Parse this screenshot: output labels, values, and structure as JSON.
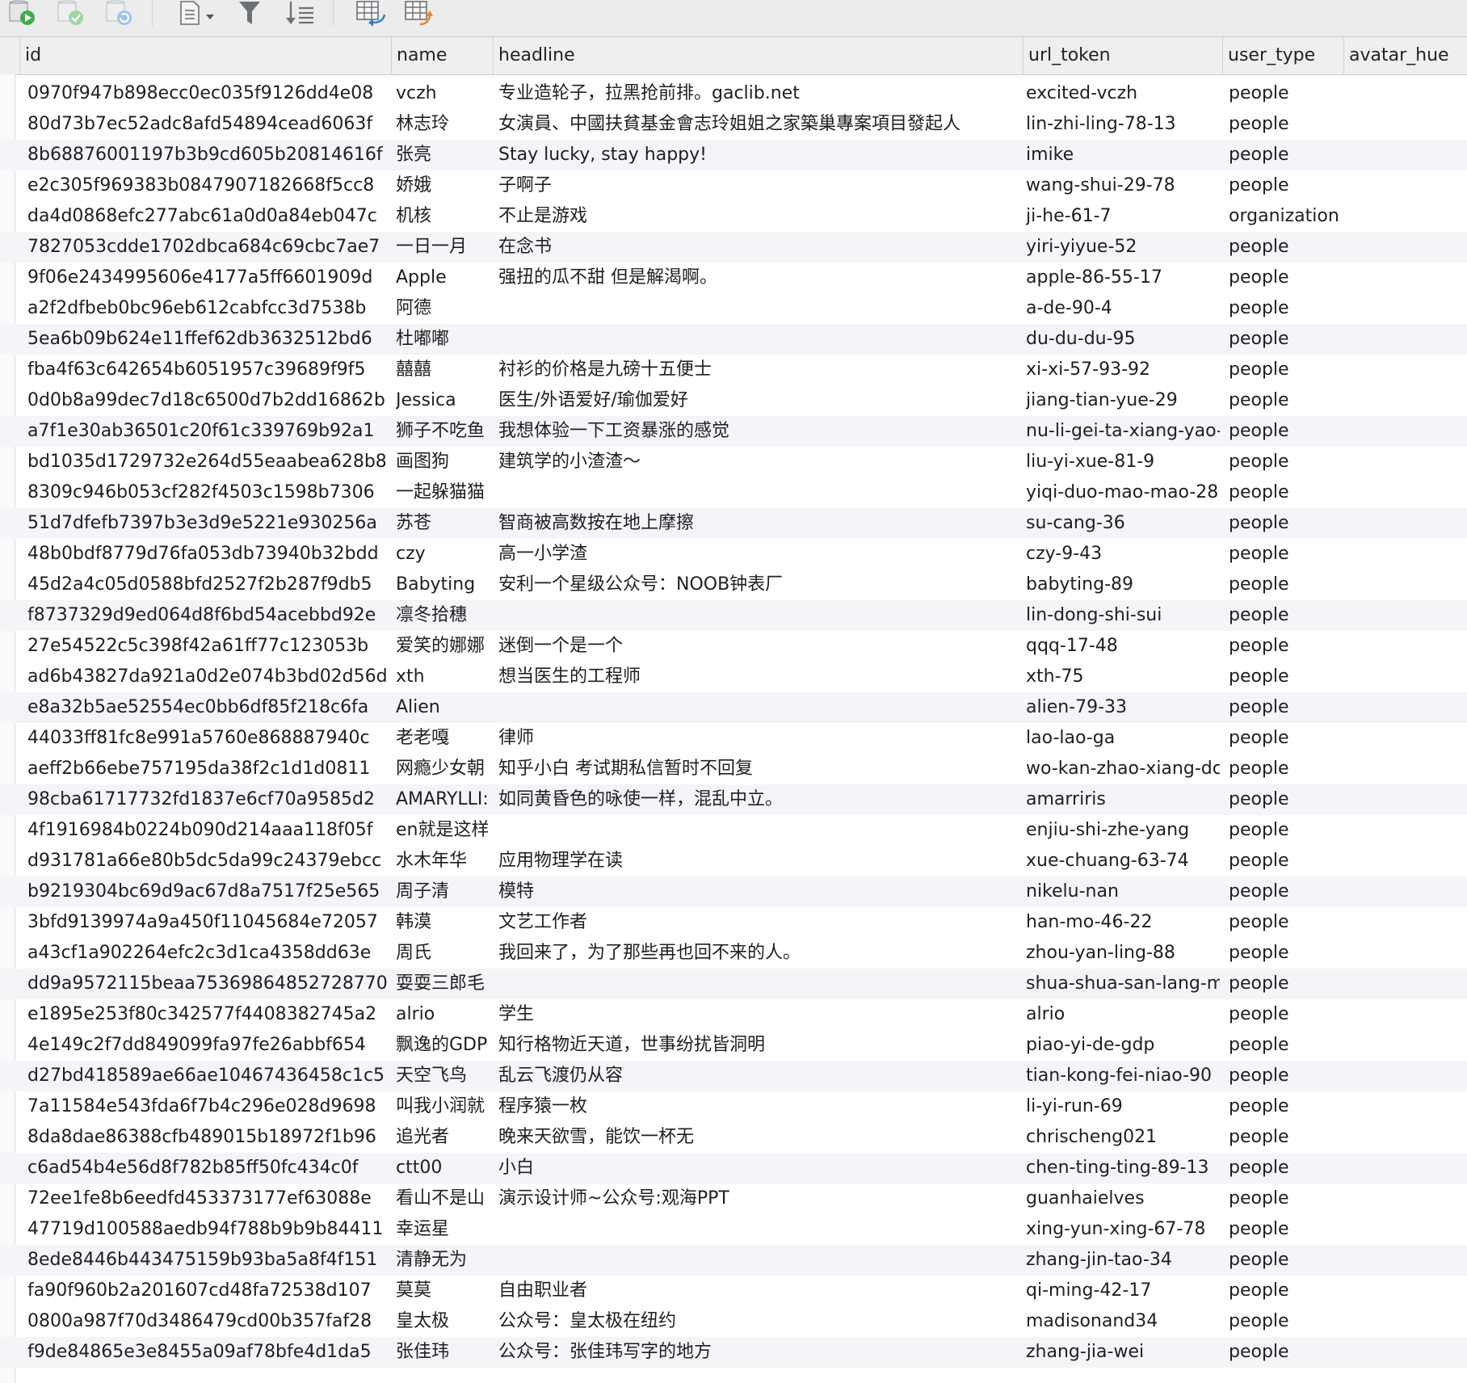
{
  "toolbar": {
    "buttons": [
      {
        "icon": "db-run-icon"
      },
      {
        "icon": "db-commit-icon"
      },
      {
        "icon": "db-refresh-icon"
      },
      {
        "icon": "document-menu-icon"
      },
      {
        "icon": "filter-icon"
      },
      {
        "icon": "sort-icon"
      },
      {
        "icon": "import-table-icon"
      },
      {
        "icon": "export-table-icon"
      }
    ]
  },
  "columns": {
    "id": "id",
    "name": "name",
    "headline": "headline",
    "url_token": "url_token",
    "user_type": "user_type",
    "avatar_hue": "avatar_hue"
  },
  "rows": [
    {
      "id": "0970f947b898ecc0ec035f9126dd4e08",
      "name": "vczh",
      "headline": "专业造轮子，拉黑抢前排。gaclib.net",
      "url_token": "excited-vczh",
      "user_type": "people"
    },
    {
      "id": "80d73b7ec52adc8afd54894cead6063f",
      "name": "林志玲",
      "headline": "女演員、中國扶貧基金會志玲姐姐之家築巢專案項目發起人",
      "url_token": "lin-zhi-ling-78-13",
      "user_type": "people"
    },
    {
      "id": "8b68876001197b3b9cd605b20814616f",
      "name": "张亮",
      "headline": "Stay lucky, stay happy!",
      "url_token": "imike",
      "user_type": "people"
    },
    {
      "id": "e2c305f969383b0847907182668f5cc8",
      "name": "娇娥",
      "headline": "子啊子",
      "url_token": "wang-shui-29-78",
      "user_type": "people"
    },
    {
      "id": "da4d0868efc277abc61a0d0a84eb047c",
      "name": "机核",
      "headline": "不止是游戏",
      "url_token": "ji-he-61-7",
      "user_type": "organization"
    },
    {
      "id": "7827053cdde1702dbca684c69cbc7ae7",
      "name": "一日一月",
      "headline": "在念书",
      "url_token": "yiri-yiyue-52",
      "user_type": "people"
    },
    {
      "id": "9f06e2434995606e4177a5ff6601909d",
      "name": "Apple",
      "headline": "强扭的瓜不甜 但是解渴啊。",
      "url_token": "apple-86-55-17",
      "user_type": "people"
    },
    {
      "id": "a2f2dfbeb0bc96eb612cabfcc3d7538b",
      "name": "阿德",
      "headline": "",
      "url_token": "a-de-90-4",
      "user_type": "people"
    },
    {
      "id": "5ea6b09b624e11ffef62db3632512bd6",
      "name": "杜嘟嘟",
      "headline": "",
      "url_token": "du-du-du-95",
      "user_type": "people"
    },
    {
      "id": "fba4f63c642654b6051957c39689f9f5",
      "name": "囍囍",
      "headline": "衬衫的价格是九磅十五便士",
      "url_token": "xi-xi-57-93-92",
      "user_type": "people"
    },
    {
      "id": "0d0b8a99dec7d18c6500d7b2dd16862b",
      "name": "Jessica",
      "headline": "医生/外语爱好/瑜伽爱好",
      "url_token": "jiang-tian-yue-29",
      "user_type": "people"
    },
    {
      "id": "a7f1e30ab36501c20f61c339769b92a1",
      "name": "狮子不吃鱼",
      "headline": "我想体验一下工资暴涨的感觉",
      "url_token": "nu-li-gei-ta-xiang-yao-",
      "user_type": "people"
    },
    {
      "id": "bd1035d1729732e264d55eaabea628b8",
      "name": "画图狗",
      "headline": "建筑学的小渣渣～",
      "url_token": "liu-yi-xue-81-9",
      "user_type": "people"
    },
    {
      "id": "8309c946b053cf282f4503c1598b7306",
      "name": "一起躲猫猫",
      "headline": "",
      "url_token": "yiqi-duo-mao-mao-28",
      "user_type": "people"
    },
    {
      "id": "51d7dfefb7397b3e3d9e5221e930256a",
      "name": "苏苍",
      "headline": "智商被高数按在地上摩擦",
      "url_token": "su-cang-36",
      "user_type": "people"
    },
    {
      "id": "48b0bdf8779d76fa053db73940b32bdd",
      "name": "czy",
      "headline": "高一小学渣",
      "url_token": "czy-9-43",
      "user_type": "people"
    },
    {
      "id": "45d2a4c05d0588bfd2527f2b287f9db5",
      "name": "Babyting",
      "headline": "安利一个星级公众号：NOOB钟表厂",
      "url_token": "babyting-89",
      "user_type": "people"
    },
    {
      "id": "f8737329d9ed064d8f6bd54acebbd92e",
      "name": "凛冬拾穗",
      "headline": "",
      "url_token": "lin-dong-shi-sui",
      "user_type": "people"
    },
    {
      "id": "27e54522c5c398f42a61ff77c123053b",
      "name": "爱笑的娜娜",
      "headline": "迷倒一个是一个",
      "url_token": "qqq-17-48",
      "user_type": "people"
    },
    {
      "id": "ad6b43827da921a0d2e074b3bd02d56d",
      "name": "xth",
      "headline": "想当医生的工程师",
      "url_token": "xth-75",
      "user_type": "people"
    },
    {
      "id": "e8a32b5ae52554ec0bb6df85f218c6fa",
      "name": "Alien",
      "headline": "",
      "url_token": "alien-79-33",
      "user_type": "people"
    },
    {
      "id": "44033ff81fc8e991a5760e868887940c",
      "name": "老老嘎",
      "headline": "律师",
      "url_token": "lao-lao-ga",
      "user_type": "people"
    },
    {
      "id": "aeff2b66ebe757195da38f2c1d1d0811",
      "name": "网瘾少女朝",
      "headline": "知乎小白 考试期私信暂时不回复",
      "url_token": "wo-kan-zhao-xiang-dc",
      "user_type": "people"
    },
    {
      "id": "98cba61717732fd1837e6cf70a9585d2",
      "name": "AMARYLLI:",
      "headline": "如同黄昏色的咏使一样，混乱中立。",
      "url_token": "amarriris",
      "user_type": "people"
    },
    {
      "id": "4f1916984b0224b090d214aaa118f05f",
      "name": "en就是这样",
      "headline": "",
      "url_token": "enjiu-shi-zhe-yang",
      "user_type": "people"
    },
    {
      "id": "d931781a66e80b5dc5da99c24379ebcc",
      "name": "水木年华",
      "headline": "应用物理学在读",
      "url_token": "xue-chuang-63-74",
      "user_type": "people"
    },
    {
      "id": "b9219304bc69d9ac67d8a7517f25e565",
      "name": "周子清",
      "headline": "模特",
      "url_token": "nikelu-nan",
      "user_type": "people"
    },
    {
      "id": "3bfd9139974a9a450f11045684e72057",
      "name": "韩漠",
      "headline": "文艺工作者",
      "url_token": "han-mo-46-22",
      "user_type": "people"
    },
    {
      "id": "a43cf1a902264efc2c3d1ca4358dd63e",
      "name": "周氏",
      "headline": "我回来了，为了那些再也回不来的人。",
      "url_token": "zhou-yan-ling-88",
      "user_type": "people"
    },
    {
      "id": "dd9a9572115beaa75369864852728770",
      "name": "耍耍三郎毛",
      "headline": "",
      "url_token": "shua-shua-san-lang-m",
      "user_type": "people"
    },
    {
      "id": "e1895e253f80c342577f4408382745a2",
      "name": "alrio",
      "headline": "学生",
      "url_token": "alrio",
      "user_type": "people"
    },
    {
      "id": "4e149c2f7dd849099fa97fe26abbf654",
      "name": "飘逸的GDP",
      "headline": "知行格物近天道，世事纷扰皆洞明",
      "url_token": "piao-yi-de-gdp",
      "user_type": "people"
    },
    {
      "id": "d27bd418589ae66ae10467436458c1c5",
      "name": "天空飞鸟",
      "headline": "乱云飞渡仍从容",
      "url_token": "tian-kong-fei-niao-90",
      "user_type": "people"
    },
    {
      "id": "7a11584e543fda6f7b4c296e028d9698",
      "name": "叫我小润就",
      "headline": "程序猿一枚",
      "url_token": "li-yi-run-69",
      "user_type": "people"
    },
    {
      "id": "8da8dae86388cfb489015b18972f1b96",
      "name": "追光者",
      "headline": "晚来天欲雪，能饮一杯无",
      "url_token": "chrischeng021",
      "user_type": "people"
    },
    {
      "id": "c6ad54b4e56d8f782b85ff50fc434c0f",
      "name": "ctt00",
      "headline": "小白",
      "url_token": "chen-ting-ting-89-13",
      "user_type": "people"
    },
    {
      "id": "72ee1fe8b6eedfd453373177ef63088e",
      "name": "看山不是山",
      "headline": "演示设计师~公众号:观海PPT",
      "url_token": "guanhaielves",
      "user_type": "people"
    },
    {
      "id": "47719d100588aedb94f788b9b9b84411",
      "name": "幸运星",
      "headline": "",
      "url_token": "xing-yun-xing-67-78",
      "user_type": "people"
    },
    {
      "id": "8ede8446b443475159b93ba5a8f4f151",
      "name": "清静无为",
      "headline": "",
      "url_token": "zhang-jin-tao-34",
      "user_type": "people"
    },
    {
      "id": "fa90f960b2a201607cd48fa72538d107",
      "name": "莫莫",
      "headline": "自由职业者",
      "url_token": "qi-ming-42-17",
      "user_type": "people"
    },
    {
      "id": "0800a987f70d3486479cd00b357faf28",
      "name": "皇太极",
      "headline": "公众号：皇太极在纽约",
      "url_token": "madisonand34",
      "user_type": "people"
    },
    {
      "id": "f9de84865e3e8455a09af78bfe4d1da5",
      "name": "张佳玮",
      "headline": "公众号：张佳玮写字的地方",
      "url_token": "zhang-jia-wei",
      "user_type": "people"
    }
  ]
}
